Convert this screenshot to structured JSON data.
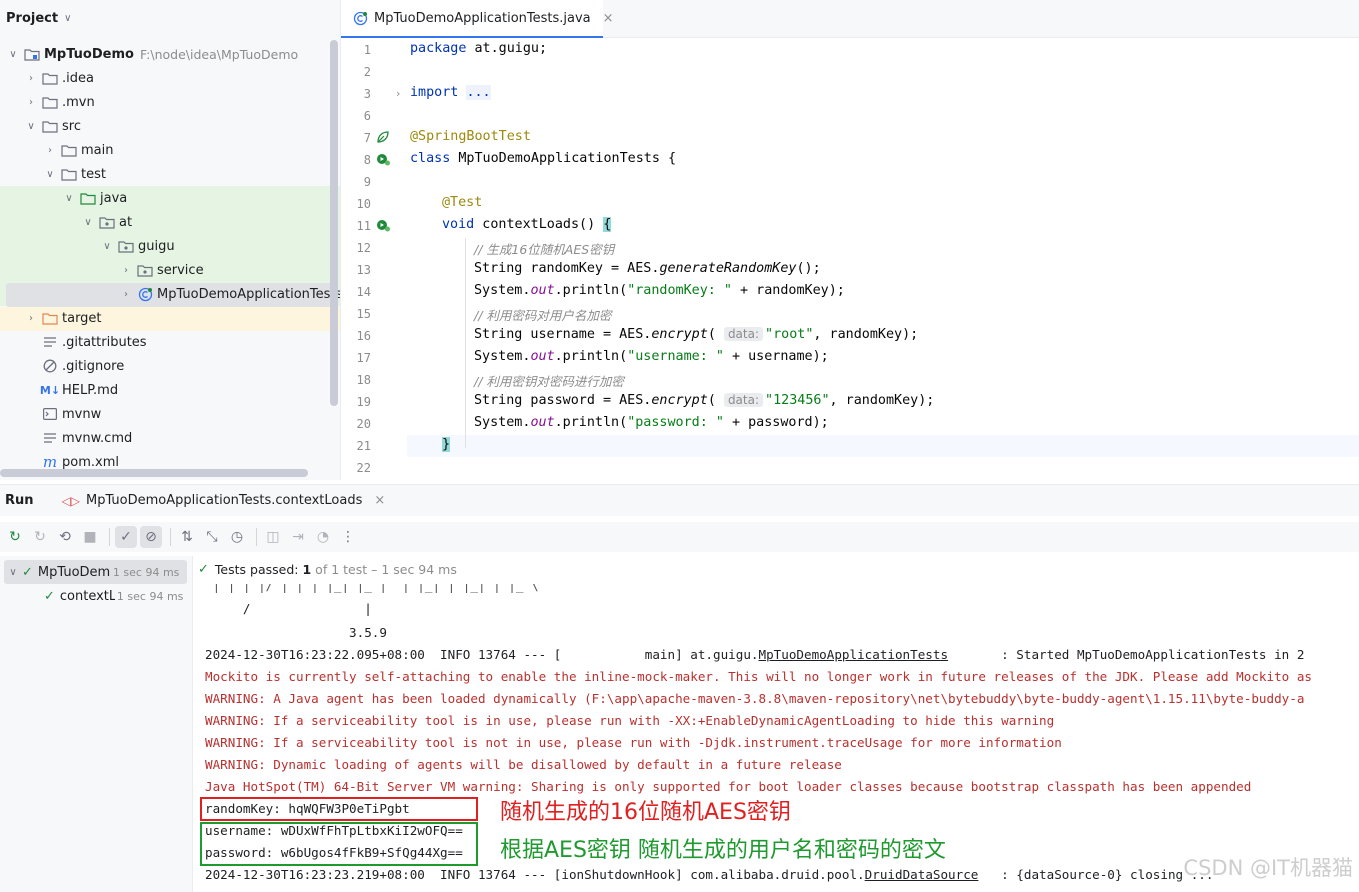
{
  "project": {
    "title": "Project",
    "items": [
      {
        "name": "MpTuoDemo",
        "path": "F:\\node\\idea\\MpTuoDemo"
      },
      {
        "name": ".idea"
      },
      {
        "name": ".mvn"
      },
      {
        "name": "src"
      },
      {
        "name": "main"
      },
      {
        "name": "test"
      },
      {
        "name": "java"
      },
      {
        "name": "at"
      },
      {
        "name": "guigu"
      },
      {
        "name": "service"
      },
      {
        "name": "MpTuoDemoApplicationTests"
      },
      {
        "name": "target"
      },
      {
        "name": ".gitattributes"
      },
      {
        "name": ".gitignore"
      },
      {
        "name": "HELP.md"
      },
      {
        "name": "mvnw"
      },
      {
        "name": "mvnw.cmd"
      },
      {
        "name": "pom.xml"
      }
    ]
  },
  "editor": {
    "tab": "MpTuoDemoApplicationTests.java",
    "line_numbers": [
      "1",
      "2",
      "3",
      "6",
      "7",
      "8",
      "9",
      "10",
      "11",
      "12",
      "13",
      "14",
      "15",
      "16",
      "17",
      "18",
      "19",
      "20",
      "21",
      "22"
    ],
    "code": {
      "l1_kw": "package",
      "l1_rest": " at.guigu;",
      "l3_kw": "import",
      "l3_fold": "...",
      "l7": "@SpringBootTest",
      "l8_kw": "class",
      "l8_rest": " MpTuoDemoApplicationTests {",
      "l10": "@Test",
      "l11_kw": "void",
      "l11_rest": " contextLoads() ",
      "l11_brace": "{",
      "l12": "// 生成16位随机AES密钥",
      "l13_a": "String randomKey = AES.",
      "l13_m": "generateRandomKey",
      "l13_b": "();",
      "l14_a": "System.",
      "l14_f": "out",
      "l14_b": ".println(",
      "l14_s": "\"randomKey: \"",
      "l14_c": " + randomKey);",
      "l15": "// 利用密码对用户名加密",
      "l16_a": "String username = AES.",
      "l16_m": "encrypt",
      "l16_b": "(",
      "l16_hint": "data:",
      "l16_s": "\"root\"",
      "l16_c": ", randomKey);",
      "l17_a": "System.",
      "l17_f": "out",
      "l17_b": ".println(",
      "l17_s": "\"username: \"",
      "l17_c": " + username);",
      "l18": "// 利用密钥对密码进行加密",
      "l19_a": "String password = AES.",
      "l19_m": "encrypt",
      "l19_b": "(",
      "l19_hint": "data:",
      "l19_s": "\"123456\"",
      "l19_c": ", randomKey);",
      "l20_a": "System.",
      "l20_f": "out",
      "l20_b": ".println(",
      "l20_s": "\"password: \"",
      "l20_c": " + password);",
      "l21": "}"
    }
  },
  "run": {
    "title": "Run",
    "tab": "MpTuoDemoApplicationTests.contextLoads",
    "tests": [
      {
        "name": "MpTuoDemo",
        "duration": "1 sec 94 ms"
      },
      {
        "name": "contextLo",
        "duration": "1 sec 94 ms"
      }
    ],
    "status": {
      "label": "Tests passed:",
      "count": "1",
      "rest": "of 1 test – 1 sec 94 ms"
    },
    "console": {
      "banner1": " | | | |/ | | | |_| |_ |  | |_| | |_| | |_ \\",
      "banner2": "     /               |",
      "version": "                   3.5.9",
      "started_a": "2024-12-30T16:23:22.095+08:00  INFO 13764 --- [           main] at.guigu.",
      "started_u": "MpTuoDemoApplicationTests",
      "started_b": "       : Started MpTuoDemoApplicationTests in 2",
      "mockito": "Mockito is currently self-attaching to enable the inline-mock-maker. This will no longer work in future releases of the JDK. Please add Mockito as",
      "warn1": "WARNING: A Java agent has been loaded dynamically (F:\\app\\apache-maven-3.8.8\\maven-repository\\net\\bytebuddy\\byte-buddy-agent\\1.15.11\\byte-buddy-a",
      "warn2": "WARNING: If a serviceability tool is in use, please run with -XX:+EnableDynamicAgentLoading to hide this warning",
      "warn3": "WARNING: If a serviceability tool is not in use, please run with -Djdk.instrument.traceUsage for more information",
      "warn4": "WARNING: Dynamic loading of agents will be disallowed by default in a future release",
      "jvm": "Java HotSpot(TM) 64-Bit Server VM warning: Sharing is only supported for boot loader classes because bootstrap classpath has been appended",
      "randomKey": "randomKey: hqWQFW3P0eTiPgbt",
      "username": "username: wDUxWfFhTpLtbxKiI2wOFQ==",
      "password": "password: w6bUgos4fFkB9+SfQg44Xg==",
      "shutdown_a": "2024-12-30T16:23:23.219+08:00  INFO 13764 --- [ionShutdownHook] com.alibaba.druid.pool.",
      "shutdown_u": "DruidDataSource",
      "shutdown_b": "   : {dataSource-0} closing ..."
    },
    "note_red": "随机生成的16位随机AES密钥",
    "note_green": "根据AES密钥 随机生成的用户名和密码的密文"
  },
  "watermark": "CSDN @IT机器猫",
  "colors": {
    "accent": "#3574f0",
    "red_note": "#e02020",
    "green_note": "#1f9a2f"
  }
}
